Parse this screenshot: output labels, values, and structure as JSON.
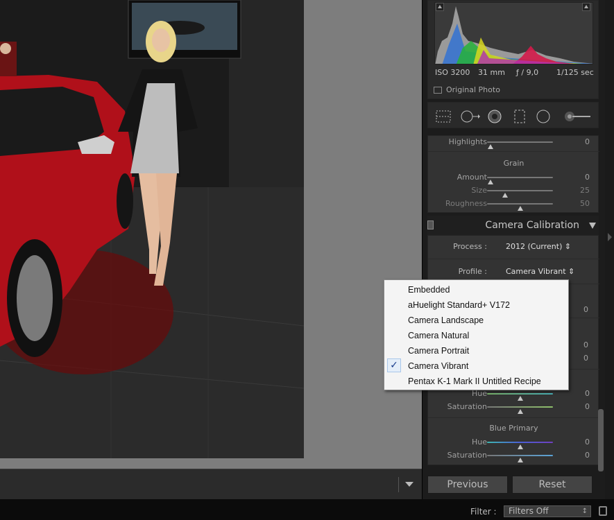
{
  "histogram": {
    "exif": {
      "iso": "ISO 3200",
      "focal": "31 mm",
      "aperture": "ƒ / 9,0",
      "shutter": "1/125 sec"
    },
    "original_photo_label": "Original Photo"
  },
  "effects": {
    "highlights": {
      "label": "Highlights",
      "value": "0",
      "position": 0.05
    },
    "grain": {
      "title": "Grain",
      "amount": {
        "label": "Amount",
        "value": "0",
        "position": 0.05
      },
      "size": {
        "label": "Size",
        "value": "25",
        "position": 0.27
      },
      "roughness": {
        "label": "Roughness",
        "value": "50",
        "position": 0.5
      }
    }
  },
  "camera_calibration": {
    "title": "Camera Calibration",
    "process": {
      "label": "Process :",
      "value": "2012 (Current) ⇕"
    },
    "profile": {
      "label": "Profile :",
      "value": "Camera Vibrant ⇕"
    },
    "hidden_values": [
      "0",
      "0",
      "0"
    ],
    "green_primary": {
      "hue": {
        "label": "Hue",
        "value": "0",
        "position": 0.5
      },
      "saturation": {
        "label": "Saturation",
        "value": "0",
        "position": 0.5
      }
    },
    "blue_primary": {
      "title": "Blue Primary",
      "hue": {
        "label": "Hue",
        "value": "0",
        "position": 0.5
      },
      "saturation": {
        "label": "Saturation",
        "value": "0",
        "position": 0.5
      }
    }
  },
  "buttons": {
    "previous": "Previous",
    "reset": "Reset"
  },
  "filter": {
    "label": "Filter :",
    "value": "Filters Off"
  },
  "profile_menu": {
    "items": [
      "Embedded",
      "aHuelight Standard+ V172",
      "Camera Landscape",
      "Camera Natural",
      "Camera Portrait",
      "Camera Vibrant",
      "Pentax K-1 Mark II Untitled Recipe"
    ],
    "selected_index": 5,
    "check_glyph": "✓"
  },
  "colors": {
    "panel_bg": "#333333",
    "accent_check": "#173b8c",
    "menu_bg": "#f4f4f4"
  }
}
